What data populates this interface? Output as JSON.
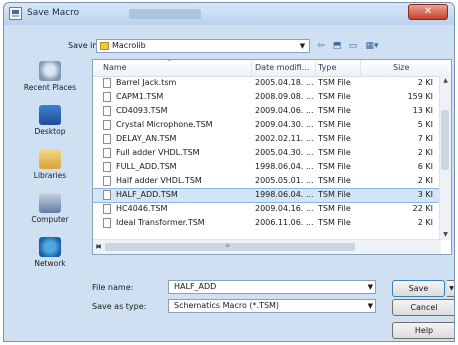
{
  "window": {
    "title": "Save Macro",
    "close_glyph": "✕"
  },
  "savein": {
    "label": "Save in:",
    "value": "Macrolib"
  },
  "places": [
    {
      "label": "Recent Places",
      "icon": "recent-places-icon"
    },
    {
      "label": "Desktop",
      "icon": "desktop-icon"
    },
    {
      "label": "Libraries",
      "icon": "libraries-icon"
    },
    {
      "label": "Computer",
      "icon": "computer-icon"
    },
    {
      "label": "Network",
      "icon": "network-icon"
    }
  ],
  "columns": {
    "name": "Name",
    "date": "Date modifi...",
    "type": "Type",
    "size": "Size"
  },
  "files": [
    {
      "name": "Barrel Jack.tsm",
      "date": "2005.04.18. ...",
      "type": "TSM File",
      "size": "2 KI"
    },
    {
      "name": "CAPM1.TSM",
      "date": "2008.09.08. ...",
      "type": "TSM File",
      "size": "159 KI"
    },
    {
      "name": "CD4093.TSM",
      "date": "2009.04.06. ...",
      "type": "TSM File",
      "size": "13 KI"
    },
    {
      "name": "Crystal Microphone.TSM",
      "date": "2009.04.30. ...",
      "type": "TSM File",
      "size": "5 KI"
    },
    {
      "name": "DELAY_AN.TSM",
      "date": "2002.02.11. ...",
      "type": "TSM File",
      "size": "7 KI"
    },
    {
      "name": "Full adder VHDL.TSM",
      "date": "2005.04.30. ...",
      "type": "TSM File",
      "size": "2 KI"
    },
    {
      "name": "FULL_ADD.TSM",
      "date": "1998.06.04. ...",
      "type": "TSM File",
      "size": "6 KI"
    },
    {
      "name": "Half adder VHDL.TSM",
      "date": "2005.05.01. ...",
      "type": "TSM File",
      "size": "2 KI"
    },
    {
      "name": "HALF_ADD.TSM",
      "date": "1998.06.04. ...",
      "type": "TSM File",
      "size": "3 KI",
      "selected": true
    },
    {
      "name": "HC4046.TSM",
      "date": "2009.04.16. ...",
      "type": "TSM File",
      "size": "22 KI"
    },
    {
      "name": "Ideal Transformer.TSM",
      "date": "2006.11.06. ...",
      "type": "TSM File",
      "size": "2 KI"
    }
  ],
  "form": {
    "filename_label": "File name:",
    "filename_value": "HALF_ADD",
    "savetype_label": "Save as type:",
    "savetype_value": "Schematics Macro (*.TSM)"
  },
  "buttons": {
    "save": "Save",
    "cancel": "Cancel",
    "help": "Help"
  },
  "colors": {
    "selection": "#d2e5f9",
    "chrome": "#cfe0f2",
    "close_button": "#c4402a"
  }
}
